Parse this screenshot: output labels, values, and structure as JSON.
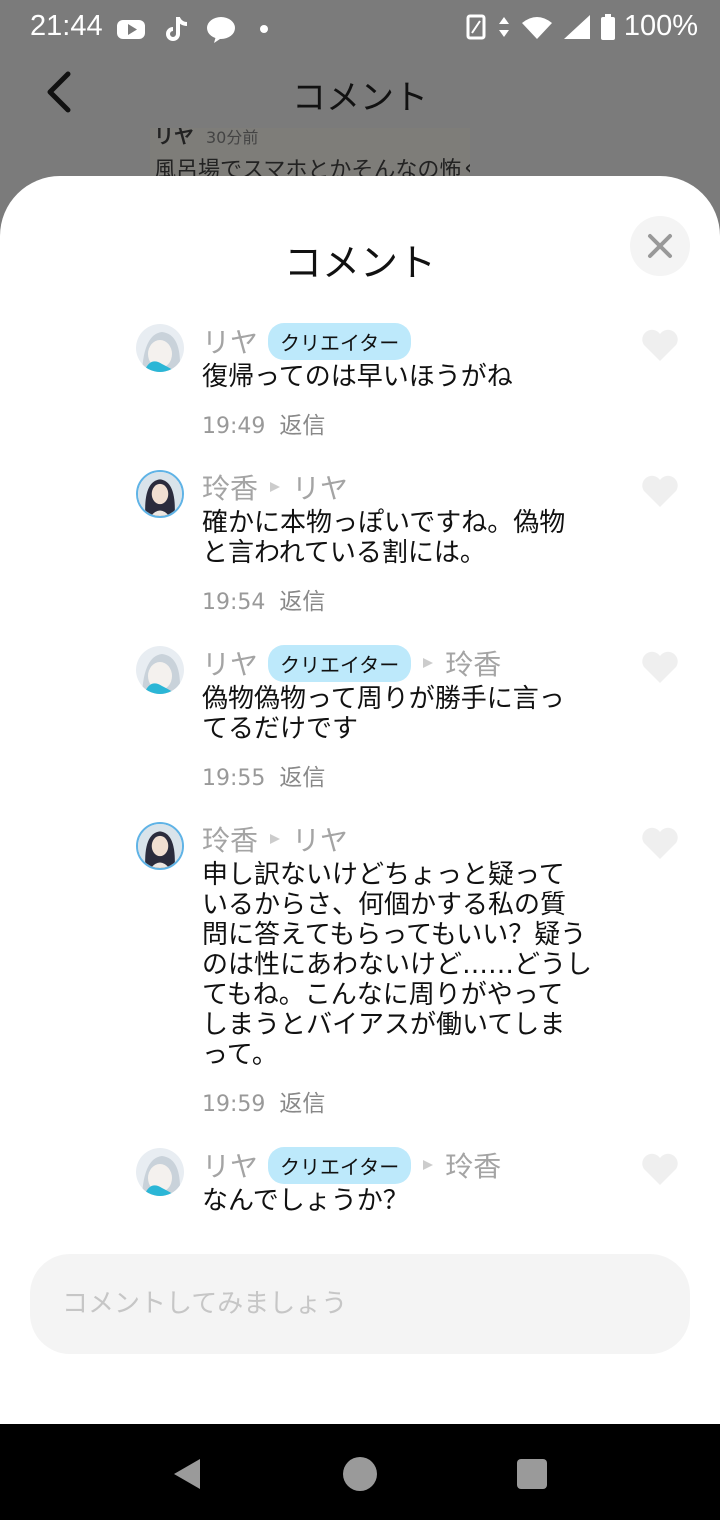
{
  "status_bar": {
    "time": "21:44",
    "battery": "100%",
    "app_icons": [
      "youtube-icon",
      "tiktok-icon",
      "line-icon",
      "dot-icon"
    ]
  },
  "background_page": {
    "title": "コメント",
    "snippet_name": "リヤ",
    "snippet_time": "30分前",
    "snippet_text": "風呂場でスマホとかそんなの怖く"
  },
  "sheet": {
    "title": "コメント",
    "close_icon": "close-icon"
  },
  "comments": [
    {
      "author": "リヤ",
      "badge": "クリエイター",
      "reply_to": "",
      "lines": [
        "復帰ってのは早いほうがね"
      ],
      "time": "19:49",
      "reply_label": "返信"
    },
    {
      "author": "玲香",
      "badge": "",
      "reply_to": "リヤ",
      "lines": [
        "確かに本物っぽいですね。偽物",
        "と言われている割には。"
      ],
      "time": "19:54",
      "reply_label": "返信"
    },
    {
      "author": "リヤ",
      "badge": "クリエイター",
      "reply_to": "玲香",
      "lines": [
        "偽物偽物って周りが勝手に言っ",
        "てるだけです"
      ],
      "time": "19:55",
      "reply_label": "返信"
    },
    {
      "author": "玲香",
      "badge": "",
      "reply_to": "リヤ",
      "lines": [
        "申し訳ないけどちょっと疑って",
        "いるからさ、何個かする私の質",
        "問に答えてもらってもいい？疑う",
        "のは性にあわないけど……どうし",
        "てもね。こんなに周りがやって",
        "しまうとバイアスが働いてしま",
        "って。"
      ],
      "time": "19:59",
      "reply_label": "返信"
    },
    {
      "author": "リヤ",
      "badge": "クリエイター",
      "reply_to": "玲香",
      "lines": [
        "なんでしょうか？"
      ],
      "time": "",
      "reply_label": ""
    }
  ],
  "input": {
    "placeholder": "コメントしてみましょう",
    "value": ""
  },
  "colors": {
    "badge_bg": "#bde9fb",
    "avatar_ring": "#5fb3e6",
    "overlay": "#7b7b7b"
  }
}
